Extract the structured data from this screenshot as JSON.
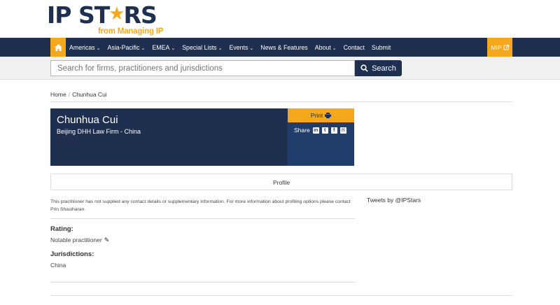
{
  "logo": {
    "main_left": "IP ST",
    "main_right": "RS",
    "sub": "from Managing IP"
  },
  "nav": {
    "home_icon": "home-icon",
    "items": [
      {
        "label": "Americas",
        "dropdown": true
      },
      {
        "label": "Asia-Pacific",
        "dropdown": true
      },
      {
        "label": "EMEA",
        "dropdown": true
      },
      {
        "label": "Special Lists",
        "dropdown": true
      },
      {
        "label": "Events",
        "dropdown": true
      },
      {
        "label": "News & Features",
        "dropdown": false
      },
      {
        "label": "About",
        "dropdown": true
      },
      {
        "label": "Contact",
        "dropdown": false
      },
      {
        "label": "Submit",
        "dropdown": false
      }
    ],
    "mip_label": "MIP"
  },
  "search": {
    "placeholder": "Search for firms, practitioners and jurisdictions",
    "button_label": "Search"
  },
  "breadcrumb": {
    "home": "Home",
    "current": "Chunhua Cui"
  },
  "profile": {
    "name": "Chunhua Cui",
    "firm": "Beijing DHH Law Firm - China",
    "print_label": "Print",
    "share_label": "Share",
    "tab_label": "Profile",
    "info_text": "This practitioner has not supplied any contact details or supplementary information. For more information about profiling options please contact Prin Shasiharan.",
    "rating_label": "Rating:",
    "rating_value": "Notable practitioner",
    "jurisdictions_label": "Jurisdictions:",
    "jurisdictions_value": "China"
  },
  "tweets_label": "Tweets by @IPStars",
  "colors": {
    "navy": "#1f2f4f",
    "accent": "#f5a81c",
    "share_blue": "#213d6b"
  }
}
